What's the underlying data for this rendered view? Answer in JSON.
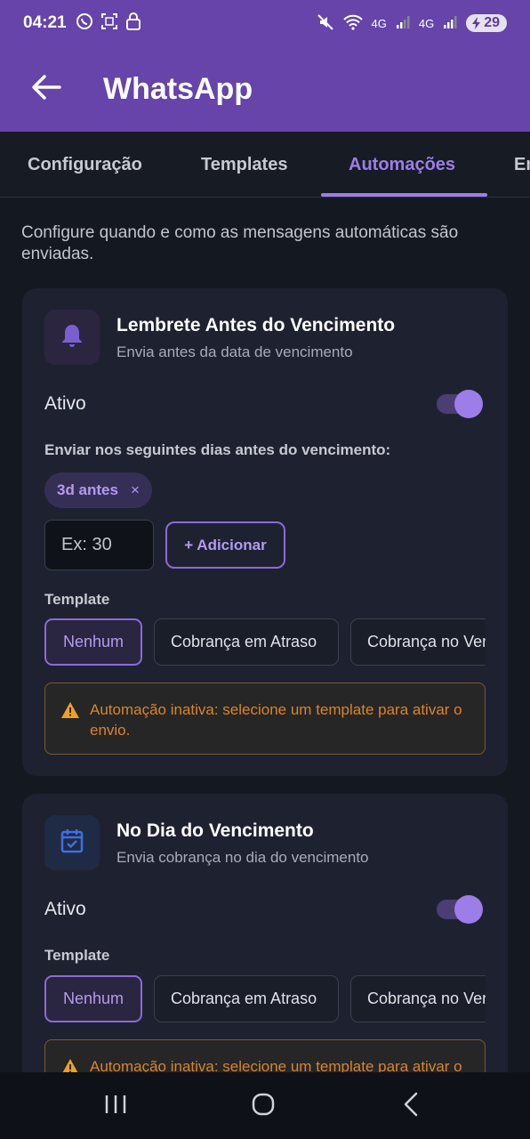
{
  "status_bar": {
    "time": "04:21",
    "left_icons": [
      "whatsapp-icon",
      "scan-icon",
      "lock-icon"
    ],
    "right_icons": [
      "mute-icon",
      "wifi-icon",
      "signal-icon",
      "signal-icon"
    ],
    "network_label_1": "4G",
    "network_label_2": "4G",
    "battery": "29"
  },
  "app_bar": {
    "title": "WhatsApp",
    "back_icon": "arrow-left-icon",
    "color": "#6644aa"
  },
  "tabs": [
    {
      "label": "Configuração",
      "active": false
    },
    {
      "label": "Templates",
      "active": false
    },
    {
      "label": "Automações",
      "active": true
    },
    {
      "label": "En",
      "active": false
    }
  ],
  "intro": "Configure quando e como as mensagens automáticas são enviadas.",
  "cards": [
    {
      "title": "Lembrete Antes do Vencimento",
      "subtitle": "Envia antes da data de vencimento",
      "icon": "bell-icon",
      "active_label": "Ativo",
      "active": true,
      "days_label": "Enviar nos seguintes dias antes do vencimento:",
      "chip": "3d antes",
      "chip_remove": "×",
      "input_placeholder": "Ex: 30",
      "add_button": "+ Adicionar",
      "template_label": "Template",
      "templates": [
        "Nenhum",
        "Cobrança em Atraso",
        "Cobrança no Vencimento"
      ],
      "selected_template": "Nenhum",
      "warning": "Automação inativa: selecione um template para ativar o envio."
    },
    {
      "title": "No Dia do Vencimento",
      "subtitle": "Envia cobrança no dia do vencimento",
      "icon": "calendar-check-icon",
      "active_label": "Ativo",
      "active": true,
      "template_label": "Template",
      "templates": [
        "Nenhum",
        "Cobrança em Atraso",
        "Cobrança no Vencimento"
      ],
      "selected_template": "Nenhum",
      "warning": "Automação inativa: selecione um template para ativar o envio."
    }
  ],
  "nav_bar": {
    "icons": [
      "recents-icon",
      "home-icon",
      "back-icon"
    ]
  },
  "colors": {
    "accent": "#9d7de8",
    "background": "#141821",
    "card": "#1e2230",
    "warning": "#d9842e"
  }
}
